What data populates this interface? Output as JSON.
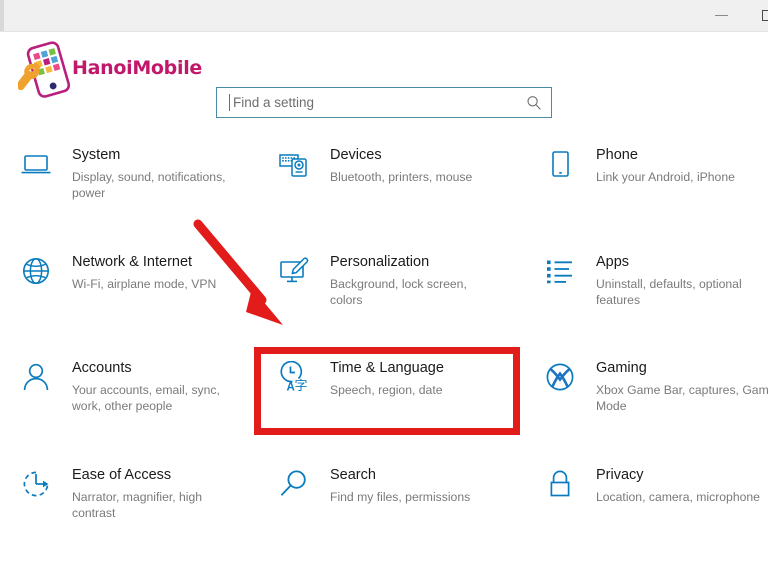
{
  "window": {
    "titlebar": {
      "minimize_label": "Minimize",
      "maximize_label": "Maximize",
      "minimize_icon": "minimize-icon",
      "maximize_icon": "maximize-icon"
    }
  },
  "branding": {
    "logo_text": "HanoiMobile",
    "logo_icon": "mobile-phone-wrench-logo",
    "logo_color": "#c2186b",
    "logo_accent": "#f0a230"
  },
  "search": {
    "placeholder": "Find a setting",
    "value": "",
    "icon": "search-icon",
    "border_color": "#4b8ba5"
  },
  "settings": {
    "accent_color": "#0a7bbf",
    "items": [
      {
        "title": "System",
        "subtitle": "Display, sound, notifications, power",
        "icon": "laptop-icon"
      },
      {
        "title": "Devices",
        "subtitle": "Bluetooth, printers, mouse",
        "icon": "devices-icon"
      },
      {
        "title": "Phone",
        "subtitle": "Link your Android, iPhone",
        "icon": "phone-icon"
      },
      {
        "title": "Network & Internet",
        "subtitle": "Wi-Fi, airplane mode, VPN",
        "icon": "globe-icon"
      },
      {
        "title": "Personalization",
        "subtitle": "Background, lock screen, colors",
        "icon": "personalization-brush-icon"
      },
      {
        "title": "Apps",
        "subtitle": "Uninstall, defaults, optional features",
        "icon": "apps-list-icon"
      },
      {
        "title": "Accounts",
        "subtitle": "Your accounts, email, sync, work, other people",
        "icon": "user-account-icon"
      },
      {
        "title": "Time & Language",
        "subtitle": "Speech, region, date",
        "icon": "clock-language-icon"
      },
      {
        "title": "Gaming",
        "subtitle": "Xbox Game Bar, captures, Game Mode",
        "icon": "xbox-icon"
      },
      {
        "title": "Ease of Access",
        "subtitle": "Narrator, magnifier, high contrast",
        "icon": "ease-of-access-icon"
      },
      {
        "title": "Search",
        "subtitle": "Find my files, permissions",
        "icon": "magnifier-icon"
      },
      {
        "title": "Privacy",
        "subtitle": "Location, camera, microphone",
        "icon": "lock-icon"
      }
    ]
  },
  "annotations": {
    "highlight_color": "#e21b1b",
    "highlighted_item": "Time & Language",
    "arrow_icon": "red-arrow-pointing-down-right"
  }
}
